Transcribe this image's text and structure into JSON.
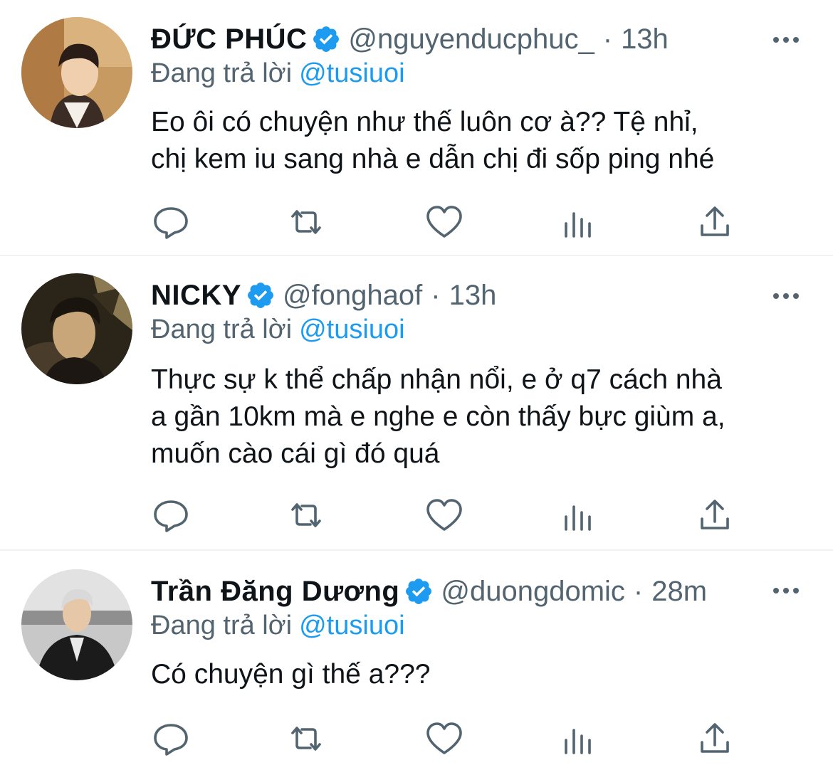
{
  "colors": {
    "accent": "#1d9bf0",
    "text": "#0f1419",
    "secondary": "#536471",
    "divider": "#eff3f4"
  },
  "tweets": [
    {
      "name": "ĐỨC PHÚC",
      "handle": "@nguyenducphuc_",
      "separator": "·",
      "time": "13h",
      "reply_label": "Đang trả lời",
      "reply_mention": "@tusiuoi",
      "text_lines": [
        "Eo ôi có chuyện như thế luôn cơ à?? Tệ nhỉ,",
        "chị kem iu sang nhà e dẫn chị đi sốp ping nhé"
      ]
    },
    {
      "name": "NICKY",
      "handle": "@fonghaof",
      "separator": "·",
      "time": "13h",
      "reply_label": "Đang trả lời",
      "reply_mention": "@tusiuoi",
      "text_lines": [
        "Thực sự k thể chấp nhận nổi, e ở q7 cách nhà",
        "a gần 10km mà e nghe e còn thấy bực giùm a,",
        "muốn cào cái gì đó quá"
      ]
    },
    {
      "name": "Trần Đăng Dương",
      "handle": "@duongdomic",
      "separator": "·",
      "time": "28m",
      "reply_label": "Đang trả lời",
      "reply_mention": "@tusiuoi",
      "text_lines": [
        "Có chuyện gì thế a???"
      ]
    }
  ],
  "icons": {
    "verified": "verified-badge-icon",
    "more": "more-options-icon",
    "reply": "reply-icon",
    "retweet": "retweet-icon",
    "like": "heart-icon",
    "analytics": "analytics-icon",
    "share": "share-icon"
  }
}
